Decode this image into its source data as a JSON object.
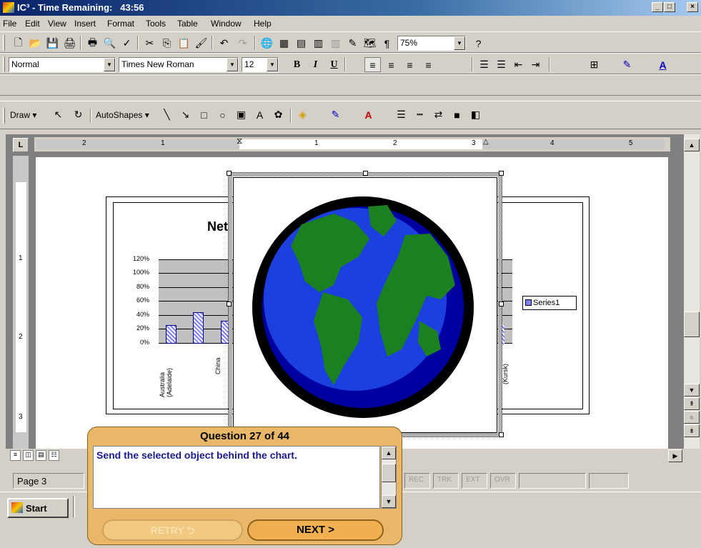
{
  "window": {
    "title": "IC³ - Time Remaining:   43:56"
  },
  "menu": [
    "File",
    "Edit",
    "View",
    "Insert",
    "Format",
    "Tools",
    "Table",
    "Window",
    "Help"
  ],
  "formatting": {
    "style": "Normal",
    "font": "Times New Roman",
    "size": "12",
    "zoom": "75%"
  },
  "drawing": {
    "draw_label": "Draw",
    "autoshapes_label": "AutoShapes"
  },
  "ruler": {
    "h_labels": [
      "2",
      "1",
      "1",
      "2",
      "3",
      "4",
      "5"
    ],
    "v_labels": [
      "1",
      "2",
      "3"
    ]
  },
  "chart_data": {
    "type": "bar",
    "title": "Net",
    "yticks": [
      "120%",
      "100%",
      "80%",
      "60%",
      "40%",
      "20%",
      "0%"
    ],
    "ylim": [
      0,
      1.2
    ],
    "categories": [
      "Australia (Adelaide)",
      "China"
    ],
    "values": [
      0.26,
      0.45,
      0.33
    ],
    "legend": [
      "Series1"
    ],
    "right_label": "(Kursk)"
  },
  "status": {
    "page": "Page 3",
    "rec": "REC",
    "trk": "TRK",
    "ext": "EXT",
    "ovr": "OVR"
  },
  "taskbar": {
    "start": "Start"
  },
  "question": {
    "title": "Question 27 of 44",
    "text": "Send the selected object behind the chart.",
    "retry": "RETRY",
    "next": "NEXT >"
  }
}
